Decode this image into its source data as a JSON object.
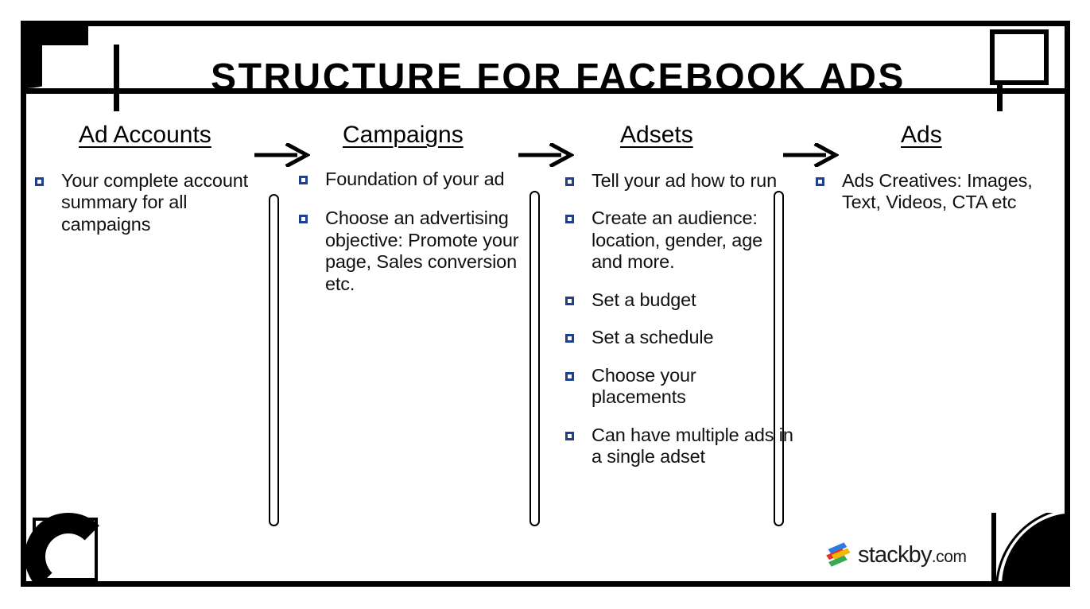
{
  "slide": {
    "title": "STRUCTURE FOR FACEBOOK ADS"
  },
  "flow": {
    "arrow_icon": "right-arrow-icon",
    "columns": [
      {
        "title": "Ad Accounts",
        "bullets": [
          "Your complete account summary for all campaigns"
        ]
      },
      {
        "title": "Campaigns",
        "bullets": [
          "Foundation of your ad",
          "Choose an advertising objective: Promote your page, Sales conversion etc."
        ]
      },
      {
        "title": "Adsets",
        "bullets": [
          "Tell your ad how to run",
          "Create an audience: location, gender, age and more.",
          "Set a budget",
          "Set a schedule",
          "Choose your placements",
          "Can have multiple ads in a single adset"
        ]
      },
      {
        "title": "Ads",
        "bullets": [
          "Ads Creatives: Images, Text, Videos, CTA etc"
        ]
      }
    ]
  },
  "branding": {
    "name": "stackby",
    "suffix": ".com",
    "mark_icon": "stackby-bars-icon",
    "mark_colors": [
      "#2C7BE5",
      "#E0342B",
      "#F2B705",
      "#38A852"
    ]
  },
  "theme": {
    "frame_color": "#000000",
    "bullet_color": "#1F3F8F",
    "text_color": "#111111",
    "background": "#ffffff"
  }
}
